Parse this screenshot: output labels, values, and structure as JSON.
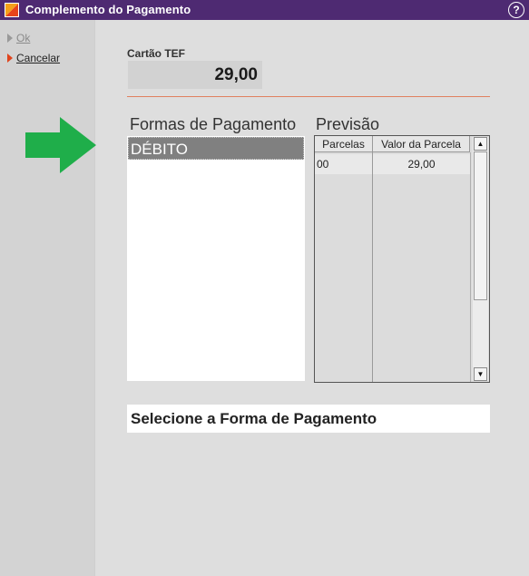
{
  "window": {
    "title": "Complemento do Pagamento",
    "help_symbol": "?"
  },
  "sidebar": {
    "items": [
      {
        "label": "Ok",
        "enabled": false
      },
      {
        "label": "Cancelar",
        "enabled": true
      }
    ]
  },
  "tef": {
    "label": "Cartão TEF",
    "value": "29,00"
  },
  "formas": {
    "label": "Formas de Pagamento",
    "items": [
      "DÉBITO"
    ]
  },
  "previsao": {
    "label": "Previsão",
    "columns": [
      "Parcelas",
      "Valor da Parcela"
    ],
    "rows": [
      {
        "parcelas": "00",
        "valor": "29,00"
      }
    ]
  },
  "status": {
    "message": "Selecione a Forma de Pagamento"
  },
  "colors": {
    "titlebar": "#4e2a72",
    "accent_arrow": "#1fae4a",
    "divider": "#e08060",
    "cancel_marker": "#e0441d"
  }
}
